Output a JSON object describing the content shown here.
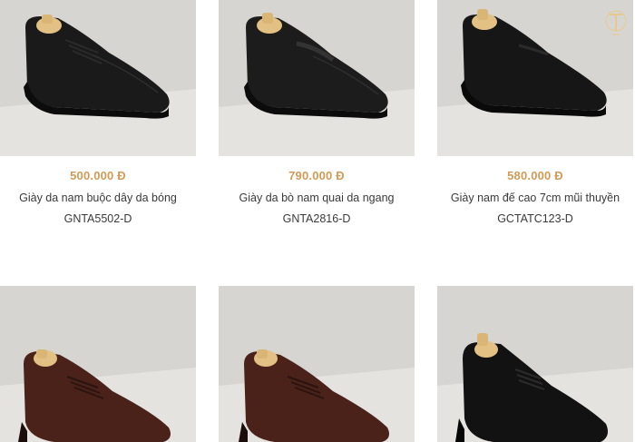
{
  "products": [
    {
      "price": "500.000 Đ",
      "name": "Giày da nam buộc dây da bóng",
      "code": "GNTA5502-D",
      "color": "#1a1a1a",
      "style": "derby"
    },
    {
      "price": "790.000 Đ",
      "name": "Giày da bò nam quai da ngang",
      "code": "GNTA2816-D",
      "color": "#1c1c1c",
      "style": "loafer"
    },
    {
      "price": "580.000 Đ",
      "name": "Giày nam đế cao 7cm mũi thuyền",
      "code": "GCTATC123-D",
      "color": "#161616",
      "style": "slipon"
    },
    {
      "color": "#4a2219",
      "style": "derby"
    },
    {
      "color": "#4a221a",
      "style": "derby"
    },
    {
      "color": "#121212",
      "style": "oxford"
    }
  ],
  "colors": {
    "price": "#d39a55",
    "text": "#3a3a3a",
    "backdrop": "#d3d1cd",
    "tree_wood": "#e3c083"
  }
}
